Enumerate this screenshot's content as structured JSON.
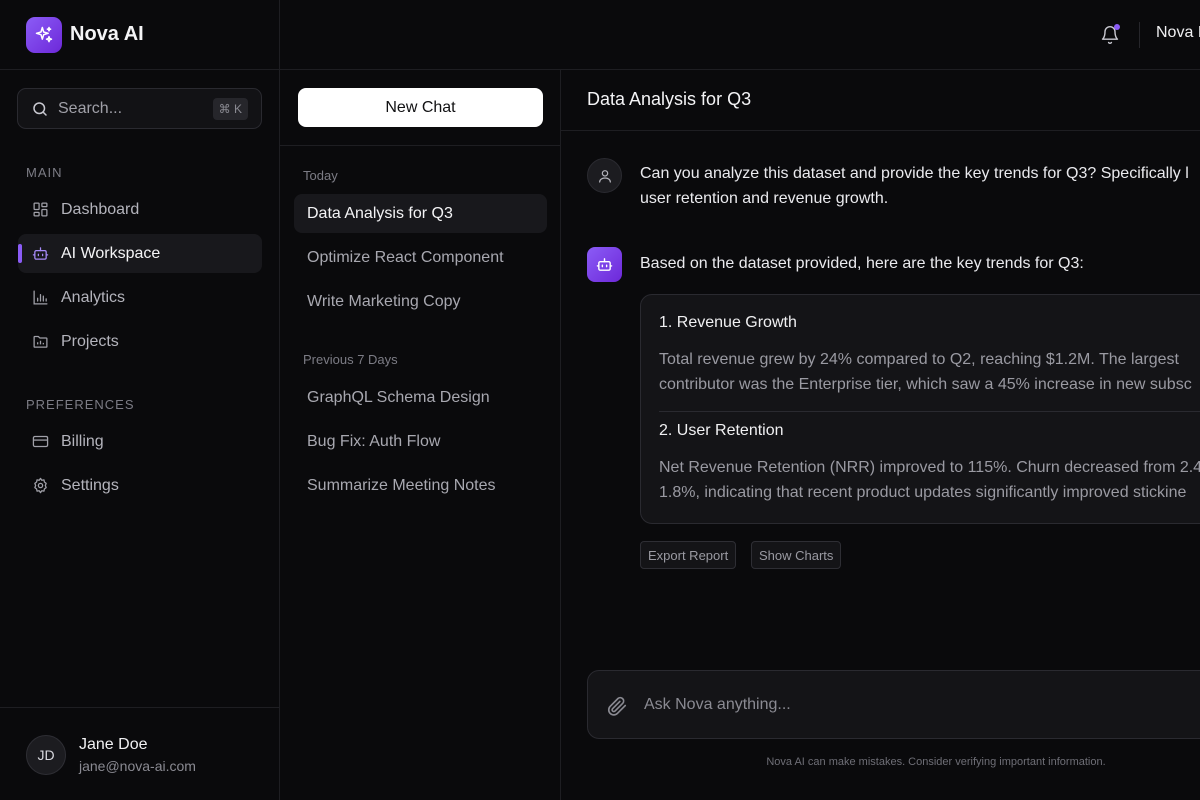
{
  "app": {
    "name": "Nova AI"
  },
  "topbar": {
    "user_name": "Nova I"
  },
  "sidebar": {
    "search_placeholder": "Search...",
    "search_shortcut": "⌘ K",
    "sections": [
      {
        "label": "MAIN",
        "items": [
          {
            "label": "Dashboard",
            "icon": "dashboard-icon",
            "active": false
          },
          {
            "label": "AI Workspace",
            "icon": "robot-icon",
            "active": true
          },
          {
            "label": "Analytics",
            "icon": "bar-chart-icon",
            "active": false
          },
          {
            "label": "Projects",
            "icon": "folder-icon",
            "active": false
          }
        ]
      },
      {
        "label": "PREFERENCES",
        "items": [
          {
            "label": "Billing",
            "icon": "credit-card-icon",
            "active": false
          },
          {
            "label": "Settings",
            "icon": "gear-icon",
            "active": false
          }
        ]
      }
    ],
    "user": {
      "initials": "JD",
      "name": "Jane Doe",
      "email": "jane@nova-ai.com"
    }
  },
  "history": {
    "new_chat_label": "New Chat",
    "groups": [
      {
        "label": "Today",
        "chats": [
          {
            "title": "Data Analysis for Q3",
            "active": true
          },
          {
            "title": "Optimize React Component",
            "active": false
          },
          {
            "title": "Write Marketing Copy",
            "active": false
          }
        ]
      },
      {
        "label": "Previous 7 Days",
        "chats": [
          {
            "title": "GraphQL Schema Design",
            "active": false
          },
          {
            "title": "Bug Fix: Auth Flow",
            "active": false
          },
          {
            "title": "Summarize Meeting Notes",
            "active": false
          }
        ]
      }
    ]
  },
  "chat": {
    "title": "Data Analysis for Q3",
    "user_message": {
      "line1": "Can you analyze this dataset and provide the key trends for Q3? Specifically l",
      "line2": "user retention and revenue growth."
    },
    "assistant_message": {
      "intro": "Based on the dataset provided, here are the key trends for Q3:",
      "sections": [
        {
          "title": "1. Revenue Growth",
          "line1": "Total revenue grew by 24% compared to Q2, reaching $1.2M. The largest",
          "line2": "contributor was the Enterprise tier, which saw a 45% increase in new subsc"
        },
        {
          "title": "2. User Retention",
          "line1": "Net Revenue Retention (NRR) improved to 115%. Churn decreased from 2.4",
          "line2": "1.8%, indicating that recent product updates significantly improved stickine"
        }
      ],
      "actions": [
        "Export Report",
        "Show Charts"
      ]
    },
    "composer_placeholder": "Ask Nova anything...",
    "disclaimer": "Nova AI can make mistakes. Consider verifying important information."
  }
}
